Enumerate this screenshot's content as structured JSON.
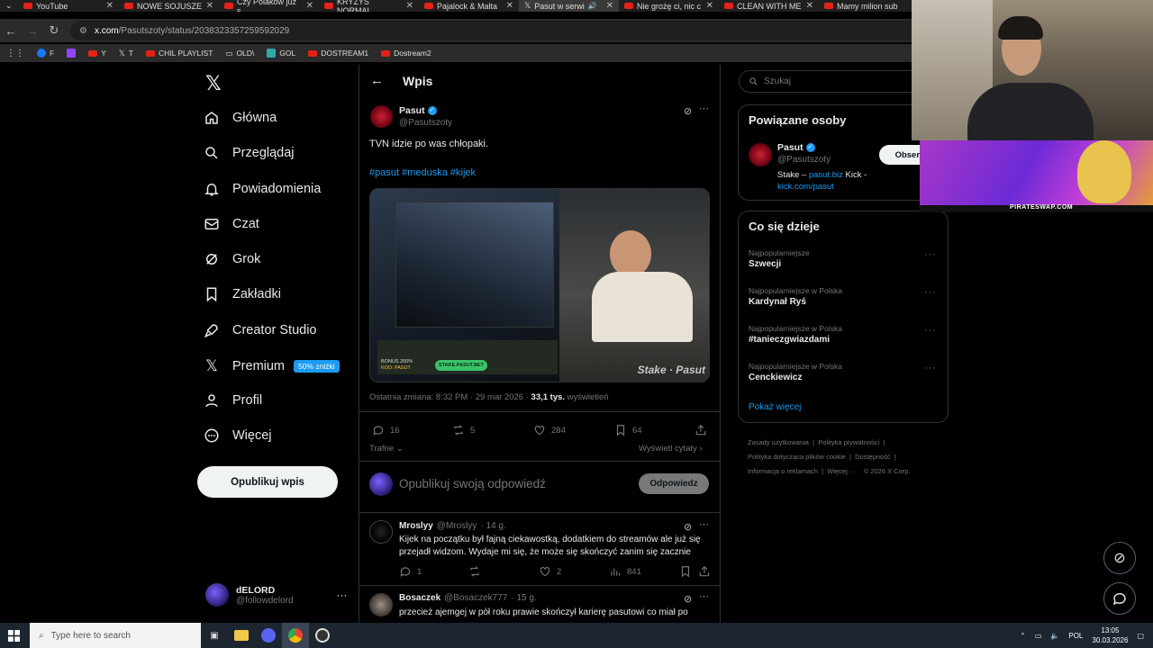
{
  "browser": {
    "tabs": [
      "YouTube",
      "NOWE SOJUSZE",
      "Czy Polaków już s",
      "KRYZYS NORMAL",
      "Pajalock & Malta",
      "Pasut w serwi",
      "Nie grożę ci, nic c",
      "CLEAN WITH ME",
      "Mamy milion sub"
    ],
    "url_domain": "x.com",
    "url_path": "/Pasutszoty/status/2038323357259592029",
    "bookmarks": [
      "F",
      "Y",
      "T",
      "CHIL PLAYLIST",
      "OLD\\",
      "GOL",
      "DOSTREAM1",
      "Dostream2"
    ]
  },
  "nav": {
    "logo": "X",
    "items": [
      "Główna",
      "Przeglądaj",
      "Powiadomienia",
      "Czat",
      "Grok",
      "Zakładki",
      "Creator Studio",
      "Premium",
      "Profil",
      "Więcej"
    ],
    "premium_badge": "50% zniżki",
    "publish_label": "Opublikuj wpis",
    "user_name": "dELORD",
    "user_handle": "@followdelord"
  },
  "post_header": {
    "back": "←",
    "title": "Wpis"
  },
  "post": {
    "author": "Pasut",
    "handle": "@Pasutszoty",
    "text": "TVN idzie po was chłopaki.",
    "hashtags": "#pasut #meduska #kijek",
    "media_bonus": "BONUS 200%",
    "media_code": "KOD: PASUT",
    "media_stake_btn": "STAKE.PASUT.BET",
    "media_watermark": "Stake · Pasut",
    "meta_prefix": "Ostatnia zmiana: 8:32 PM · 29 mar 2026 · ",
    "views_count": "33,1 tys.",
    "views_label": "wyświetleń",
    "replies": "16",
    "reposts": "5",
    "likes": "284",
    "bookmarks": "64",
    "sort_label": "Trafne",
    "quotes_label": "Wyświetl cytaty",
    "reply_placeholder": "Opublikuj swoją odpowiedź",
    "reply_button": "Odpowiedz"
  },
  "replies": [
    {
      "name": "Mroslyy",
      "handle": "@Mroslyy",
      "time": "· 14 g.",
      "text": "Kijek na początku był fajną ciekawostką, dodatkiem do streamów ale już się przejadł widzom. Wydaje mi się, że może się skończyć zanim się zacznie",
      "replies": "1",
      "reposts": "",
      "likes": "2",
      "views": "841"
    },
    {
      "name": "Bosaczek",
      "handle": "@Bosaczek777",
      "time": "· 15 g.",
      "text": "przecież ajemgej w pół roku prawie skończył karierę pasutowi co miał po"
    }
  ],
  "search": {
    "placeholder": "Szukaj"
  },
  "related": {
    "title": "Powiązane osoby",
    "name": "Pasut",
    "handle": "@Pasutszoty",
    "follow": "Obserw",
    "bio_1": "Stake – ",
    "bio_link1": "pasut.biz",
    "bio_2": " Kick -",
    "bio_link2": "kick.com/pasut"
  },
  "trends": {
    "title": "Co się dzieje",
    "items": [
      {
        "context": "Najpopularniejsze",
        "name": "Szwecji"
      },
      {
        "context": "Najpopularniejsze w Polska",
        "name": "Kardynał Ryś"
      },
      {
        "context": "Najpopularniejsze w Polska",
        "name": "#tanieczgwiazdami"
      },
      {
        "context": "Najpopularniejsze w Polska",
        "name": "Cenckiewicz"
      }
    ],
    "more": "Pokaż więcej"
  },
  "footer": {
    "links": [
      "Zasady użytkowania",
      "Polityka prywatności",
      "Polityka dotycząca plików cookie",
      "Dostępność",
      "Informacja o reklamach",
      "Więcej ···",
      "© 2026 X Corp."
    ]
  },
  "overlay": {
    "promo_text": "PIRATESWAP.COM"
  },
  "taskbar": {
    "search_placeholder": "Type here to search",
    "lang": "POL",
    "time": "13:05",
    "date": "30.03.2026"
  },
  "colors": {
    "accent": "#1d9bf0",
    "background": "#000000",
    "border": "#2f3336",
    "muted": "#71767b"
  }
}
